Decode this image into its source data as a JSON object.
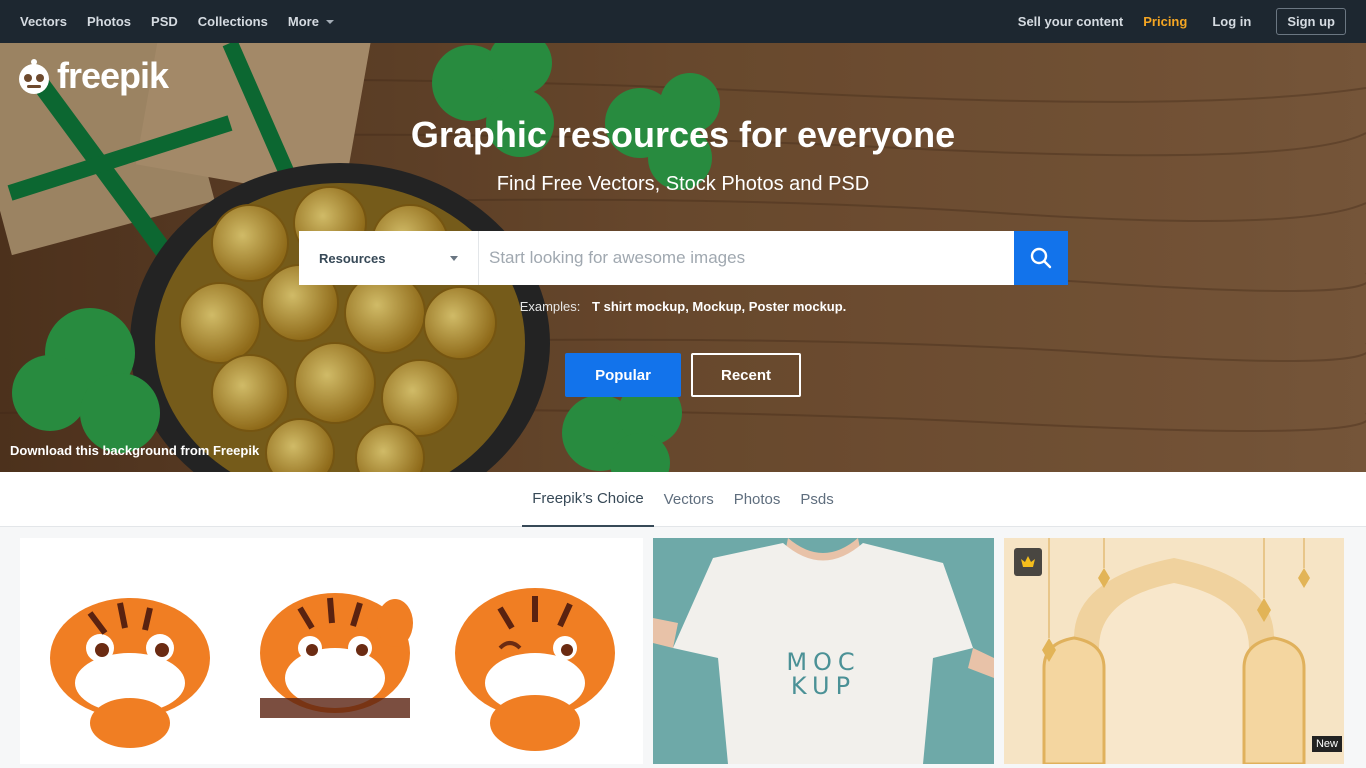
{
  "nav": {
    "left": [
      "Vectors",
      "Photos",
      "PSD",
      "Collections"
    ],
    "more": "More",
    "sell": "Sell your content",
    "pricing": "Pricing",
    "login": "Log in",
    "signup": "Sign up"
  },
  "logo": {
    "text": "freepik"
  },
  "hero": {
    "title": "Graphic resources for everyone",
    "subtitle": "Find Free Vectors, Stock Photos and PSD",
    "credit": "Download this background from Freepik"
  },
  "search": {
    "resource_type": "Resources",
    "placeholder": "Start looking for awesome images",
    "examples_label": "Examples:",
    "examples": "T shirt mockup, Mockup, Poster mockup."
  },
  "buttons": {
    "popular": "Popular",
    "recent": "Recent"
  },
  "tabs": [
    "Freepik’s Choice",
    "Vectors",
    "Photos",
    "Psds"
  ],
  "cards": {
    "mockup_line1": "MOC",
    "mockup_line2": "KUP",
    "new_badge": "New"
  },
  "colors": {
    "brand_blue": "#1273eb",
    "nav_bg": "#1d2730",
    "pricing": "#f5a623"
  }
}
